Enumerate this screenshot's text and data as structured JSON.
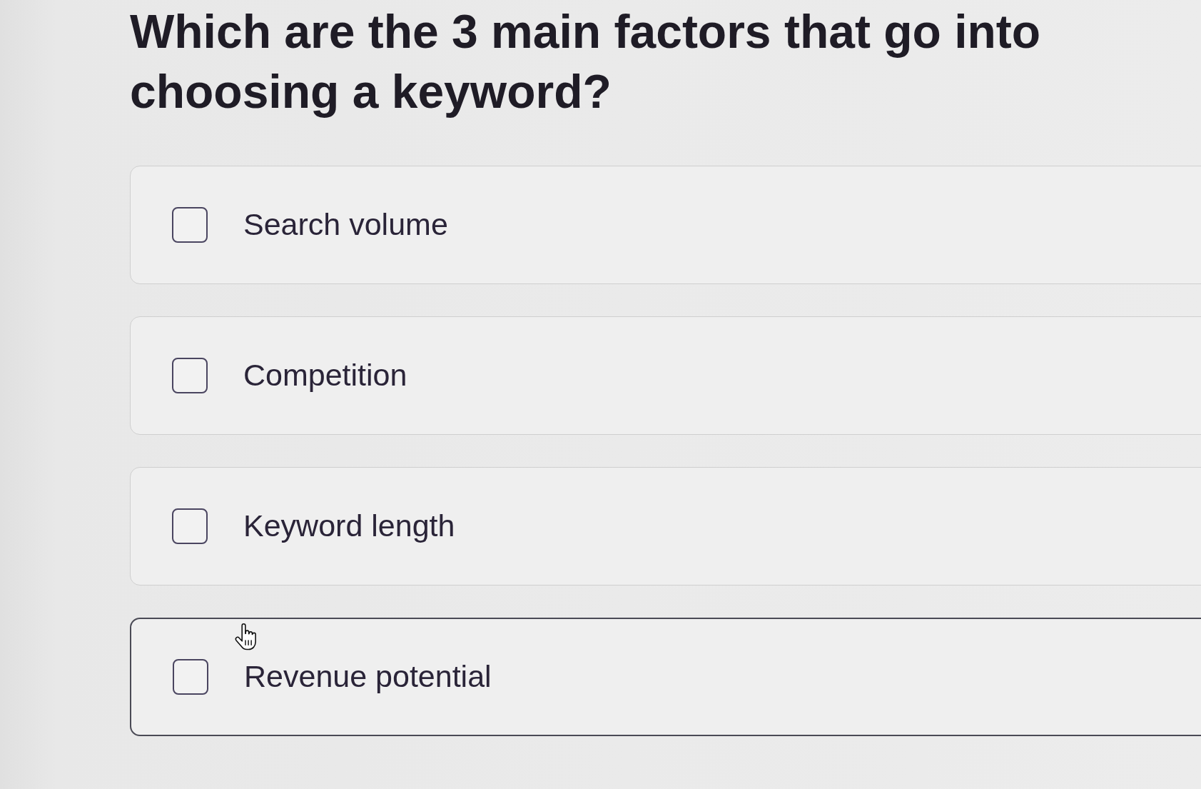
{
  "question": {
    "text": "Which are the 3 main factors that go into choosing a keyword?"
  },
  "options": [
    {
      "label": "Search volume",
      "checked": false,
      "hovered": false
    },
    {
      "label": "Competition",
      "checked": false,
      "hovered": false
    },
    {
      "label": "Keyword length",
      "checked": false,
      "hovered": false
    },
    {
      "label": "Revenue potential",
      "checked": false,
      "hovered": true
    }
  ]
}
